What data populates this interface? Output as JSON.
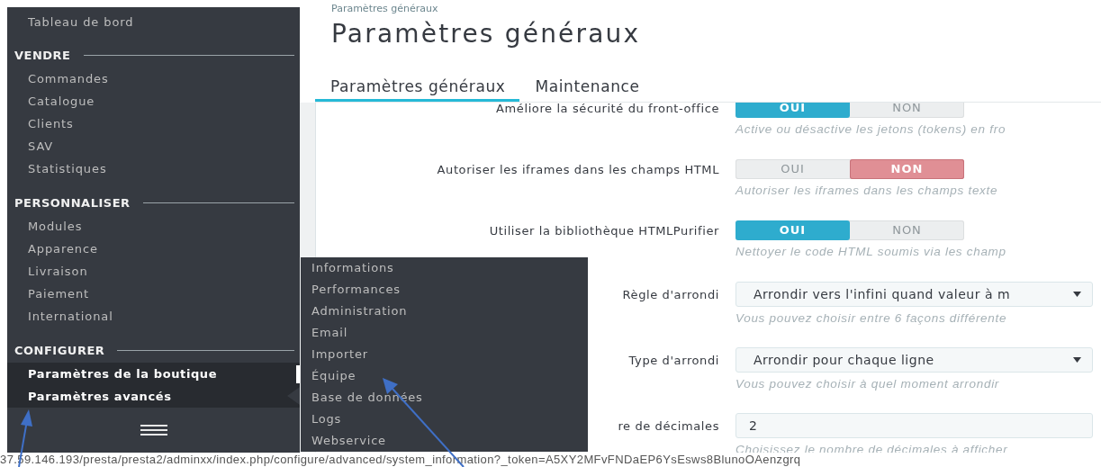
{
  "sidebar": {
    "items": [
      {
        "kind": "link",
        "label": "Tableau de bord",
        "selected": false
      },
      {
        "kind": "heading",
        "label": "VENDRE"
      },
      {
        "kind": "link",
        "label": "Commandes",
        "selected": false
      },
      {
        "kind": "link",
        "label": "Catalogue",
        "selected": false
      },
      {
        "kind": "link",
        "label": "Clients",
        "selected": false
      },
      {
        "kind": "link",
        "label": "SAV",
        "selected": false
      },
      {
        "kind": "link",
        "label": "Statistiques",
        "selected": false
      },
      {
        "kind": "heading",
        "label": "PERSONNALISER"
      },
      {
        "kind": "link",
        "label": "Modules",
        "selected": false
      },
      {
        "kind": "link",
        "label": "Apparence",
        "selected": false
      },
      {
        "kind": "link",
        "label": "Livraison",
        "selected": false
      },
      {
        "kind": "link",
        "label": "Paiement",
        "selected": false
      },
      {
        "kind": "link",
        "label": "International",
        "selected": false
      },
      {
        "kind": "heading",
        "label": "CONFIGURER"
      },
      {
        "kind": "link",
        "label": "Paramètres de la boutique",
        "selected": true
      },
      {
        "kind": "link",
        "label": "Paramètres avancés",
        "selected": true,
        "expanded": true,
        "submenu": [
          "Informations",
          "Performances",
          "Administration",
          "Email",
          "Importer",
          "Équipe",
          "Base de données",
          "Logs",
          "Webservice"
        ]
      }
    ]
  },
  "breadcrumb": "Paramètres généraux",
  "title": "Paramètres généraux",
  "tabs": [
    {
      "label": "Paramètres généraux",
      "selected": true
    },
    {
      "label": "Maintenance",
      "selected": false
    }
  ],
  "form": [
    {
      "kind": "toggle",
      "label": "Améliore la sécurité du front-office",
      "options": [
        {
          "label": "OUI",
          "selected": true
        },
        {
          "label": "NON",
          "selected": false
        }
      ],
      "help": "Active ou désactive les jetons (tokens) en fro"
    },
    {
      "kind": "toggle",
      "label": "Autoriser les iframes dans les champs HTML",
      "options": [
        {
          "label": "OUI",
          "selected": false
        },
        {
          "label": "NON",
          "selected": true
        }
      ],
      "help": "Autoriser les iframes dans les champs texte"
    },
    {
      "kind": "toggle",
      "label": "Utiliser la bibliothèque HTMLPurifier",
      "options": [
        {
          "label": "OUI",
          "selected": true
        },
        {
          "label": "NON",
          "selected": false
        }
      ],
      "help": "Nettoyer le code HTML soumis via les champ"
    },
    {
      "kind": "select",
      "label": "Règle d'arrondi",
      "value": "Arrondir vers l'infini quand valeur à m",
      "help": "Vous pouvez choisir entre 6 façons différente"
    },
    {
      "kind": "select",
      "label": "Type d'arrondi",
      "value": "Arrondir pour chaque ligne",
      "help": "Vous pouvez choisir à quel moment arrondir"
    },
    {
      "kind": "input",
      "label": "re de décimales",
      "value": "2",
      "help": "Choisissez le nombre de décimales à afficher"
    }
  ],
  "status_bar": {
    "url": "37.59.146.193/presta/presta2/adminxx/index.php/configure/advanced/system_information?_token=A5XY2MFvFNDaEP6YsEsws8BlunoOAenzgrq"
  }
}
